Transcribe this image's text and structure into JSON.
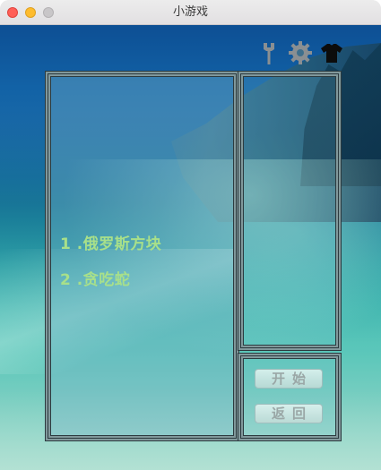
{
  "window": {
    "title": "小游戏"
  },
  "toolbar": {
    "icons": [
      "wrench-icon",
      "gear-icon",
      "shirt-icon"
    ]
  },
  "games": [
    {
      "label": "1 .俄罗斯方块"
    },
    {
      "label": "2 .贪吃蛇"
    }
  ],
  "controls": {
    "start_label": "开始",
    "back_label": "返回"
  },
  "colors": {
    "item_text": "#a8e08a",
    "panel_border": "#2c3b40",
    "button_text": "#9aa7a6"
  }
}
